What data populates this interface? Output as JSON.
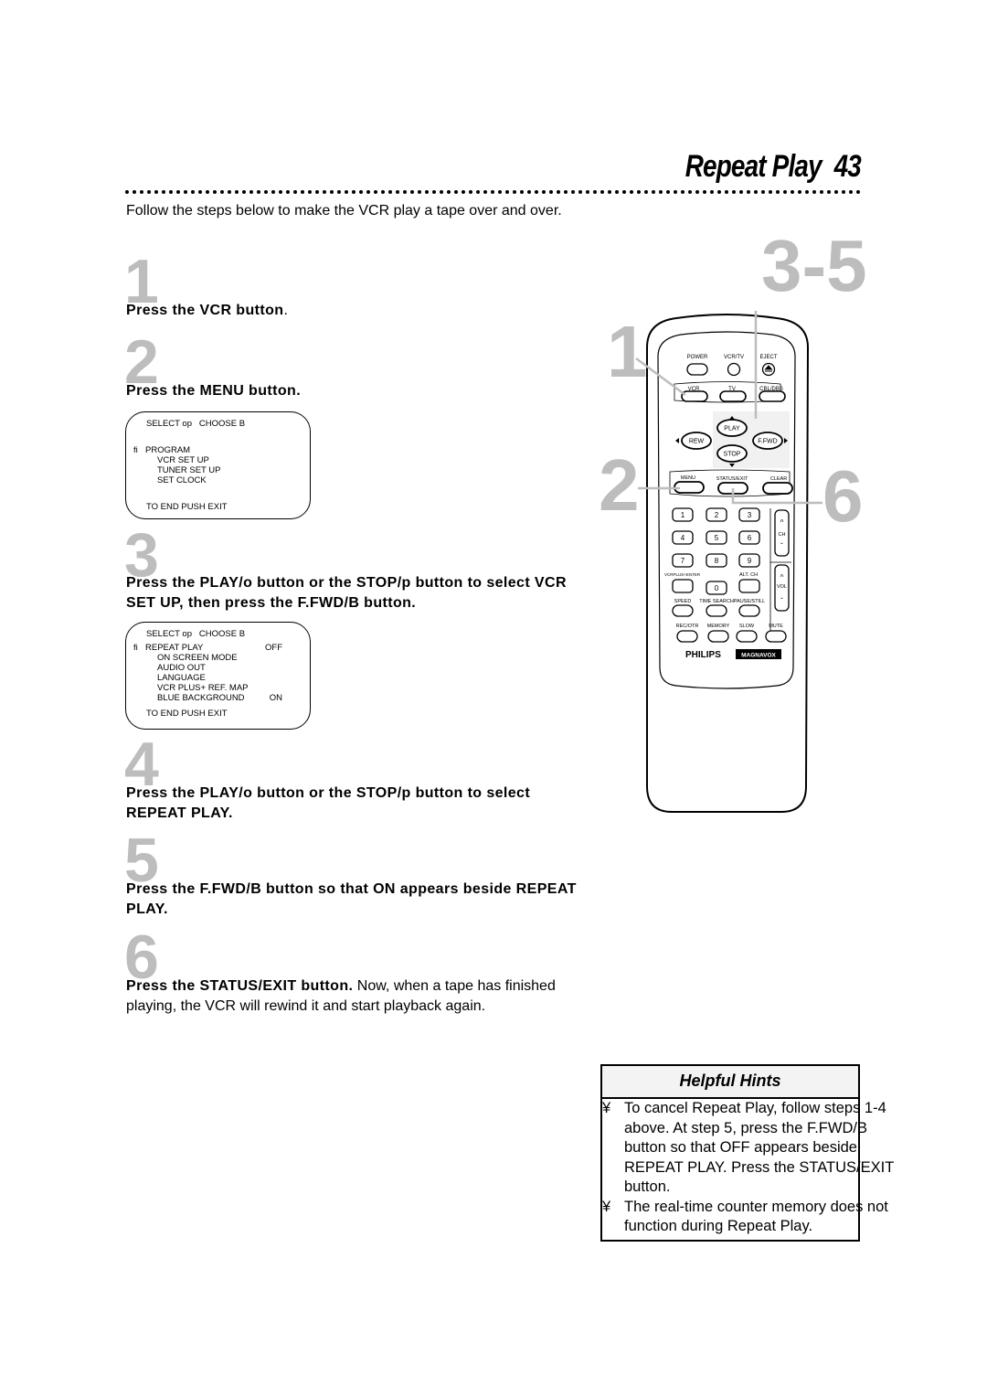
{
  "header": {
    "title": "Repeat Play",
    "page_number": "43"
  },
  "intro": "Follow the steps below to make the VCR play a tape over and over.",
  "steps": [
    {
      "number": "1",
      "bold": "Press the VCR button",
      "rest": "."
    },
    {
      "number": "2",
      "bold": "Press the MENU button.",
      "rest": ""
    },
    {
      "number": "3",
      "bold": "Press the PLAY/o  button or the STOP/p  button to select VCR SET UP, then press the F.FWD/B  button.",
      "rest": ""
    },
    {
      "number": "4",
      "bold": "Press the PLAY/o  button or the STOP/p  button to select REPEAT PLAY.",
      "rest": ""
    },
    {
      "number": "5",
      "bold": "Press the F.FWD/B  button so that ON appears beside REPEAT PLAY.",
      "rest": ""
    },
    {
      "number": "6",
      "bold": "Press the STATUS/EXIT button.",
      "rest": " Now, when a tape has finished playing, the VCR will rewind it and start playback again."
    }
  ],
  "osd_menu_1": {
    "header": "SELECT op   CHOOSE B",
    "cursor": "fi",
    "items": [
      "PROGRAM",
      "VCR SET UP",
      "TUNER SET UP",
      "SET CLOCK"
    ],
    "footer": "TO END PUSH EXIT"
  },
  "osd_menu_2": {
    "header": "SELECT op   CHOOSE B",
    "cursor": "fi",
    "items": [
      {
        "label": "REPEAT PLAY",
        "value": "OFF"
      },
      {
        "label": "ON SCREEN MODE",
        "value": ""
      },
      {
        "label": "AUDIO OUT",
        "value": ""
      },
      {
        "label": "LANGUAGE",
        "value": ""
      },
      {
        "label": "VCR PLUS+ REF. MAP",
        "value": ""
      },
      {
        "label": "BLUE BACKGROUND",
        "value": "ON"
      }
    ],
    "footer": "TO END PUSH EXIT"
  },
  "remote": {
    "callouts": {
      "top": "3-5",
      "left_1": "1",
      "left_2": "2",
      "right": "6"
    },
    "row1": [
      "POWER",
      "VCR/TV",
      "EJECT"
    ],
    "row2": [
      "VCR",
      "TV",
      "CBL/DBS"
    ],
    "transport": {
      "play": "PLAY",
      "rew": "REW",
      "ffwd": "F.FWD",
      "stop": "STOP"
    },
    "row3": [
      "MENU",
      "STATUS/EXIT",
      "CLEAR"
    ],
    "keypad": [
      "1",
      "2",
      "3",
      "4",
      "5",
      "6",
      "7",
      "8",
      "9",
      "0"
    ],
    "keypad_labels": {
      "vcrplus": "VCRPLUS+ENTER",
      "altch": "ALT. CH"
    },
    "ch_label": "CH",
    "vol_label": "VOL",
    "row4": [
      "SPEED",
      "TIME SEARCH",
      "PAUSE/STILL"
    ],
    "row5": [
      "REC/OTR",
      "MEMORY",
      "SLOW",
      "MUTE"
    ],
    "brand_1": "PHILIPS",
    "brand_2": "MAGNAVOX"
  },
  "hints": {
    "title": "Helpful Hints",
    "bullet": "¥",
    "items": [
      "To cancel Repeat Play, follow steps 1-4 above. At step 5, press the F.FWD/B  button so that OFF appears beside REPEAT PLAY. Press the STATUS/EXIT button.",
      "The real-time counter memory does not function during Repeat Play."
    ]
  }
}
